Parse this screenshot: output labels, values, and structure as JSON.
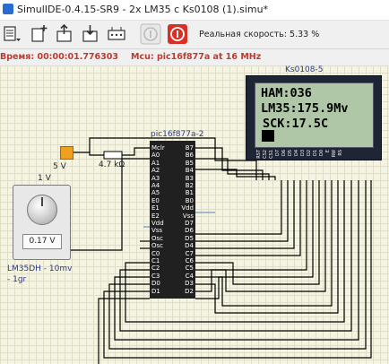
{
  "window": {
    "title": "SimulIDE-0.4.15-SR9  -  2x LM35 c Ks0108 (1).simu*"
  },
  "toolbar": {
    "buttons": [
      {
        "name": "open-menu-button",
        "icon": "file-menu-icon"
      },
      {
        "name": "new-circuit-button",
        "icon": "new-file-icon"
      },
      {
        "name": "open-circuit-button",
        "icon": "open-file-icon"
      },
      {
        "name": "save-circuit-button",
        "icon": "save-file-icon"
      },
      {
        "name": "settings-button",
        "icon": "settings-icon"
      },
      {
        "name": "pause-button",
        "icon": "pause-icon"
      },
      {
        "name": "power-button",
        "icon": "power-icon",
        "color": "#d93025"
      }
    ],
    "speed_label": "Реальная скорость: 5.33 %"
  },
  "status": {
    "time": "Время: 00:00:01.776303",
    "mcu": "Mcu: pic16f877a at 16 MHz"
  },
  "circuit": {
    "lcd": {
      "label": "Ks0108-5",
      "lines": [
        "HAM:036",
        "LM35:175.9Mv",
        "SCK:17.5C"
      ],
      "pins": [
        "RST",
        "CS2",
        "CS1",
        "D7",
        "D6",
        "D5",
        "D4",
        "D3",
        "D2",
        "D1",
        "D0",
        "E",
        "RW",
        "RS"
      ]
    },
    "mcu": {
      "label": "pic16f877a-2",
      "left_pins": [
        "Mclr",
        "A0",
        "A1",
        "A2",
        "A3",
        "A4",
        "A5",
        "E0",
        "E1",
        "E2",
        "Vdd",
        "Vss",
        "Osc",
        "Osc",
        "C0",
        "C1",
        "C2",
        "C3",
        "D0",
        "D1"
      ],
      "right_pins": [
        "B7",
        "B6",
        "B5",
        "B4",
        "B3",
        "B2",
        "B1",
        "B0",
        "Vdd",
        "Vss",
        "D7",
        "D6",
        "D5",
        "D4",
        "C7",
        "C6",
        "C5",
        "C4",
        "D3",
        "D2"
      ]
    },
    "source": {
      "label": "5 V"
    },
    "resistor": {
      "label": "4.7 kΩ"
    },
    "potentiometer": {
      "label": "1 V",
      "value": "0.17 V"
    },
    "sensor": {
      "label_line1": "LM35DH - 10mv",
      "label_line2": "- 1gr"
    },
    "colors": {
      "wire": "#000000",
      "vdd_wire": "#8aa6c8",
      "chip": "#202020",
      "lcd_screen": "#afc7a6",
      "accent_red": "#c13a2e"
    }
  }
}
